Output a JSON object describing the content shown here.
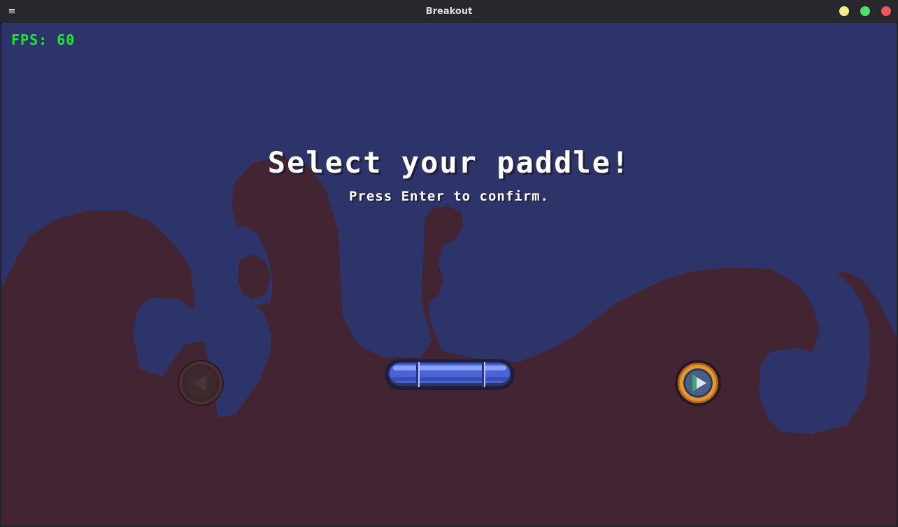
{
  "window": {
    "title": "Breakout",
    "menu_icon": "hamburger-menu-icon",
    "controls": [
      "minimize",
      "maximize",
      "close"
    ]
  },
  "hud": {
    "fps_text": "FPS: 60"
  },
  "screen": {
    "heading": "Select your paddle!",
    "instruction": "Press Enter to confirm."
  },
  "selector": {
    "prev_icon": "arrow-left-icon",
    "prev_enabled": false,
    "next_icon": "arrow-right-icon",
    "next_enabled": true,
    "paddle": "blue-paddle"
  },
  "colors": {
    "sky": "#2d3469",
    "waves": "#432432",
    "fps": "#19ea2b",
    "paddle": "#4b63d8",
    "next_ring": "#e0982f"
  }
}
